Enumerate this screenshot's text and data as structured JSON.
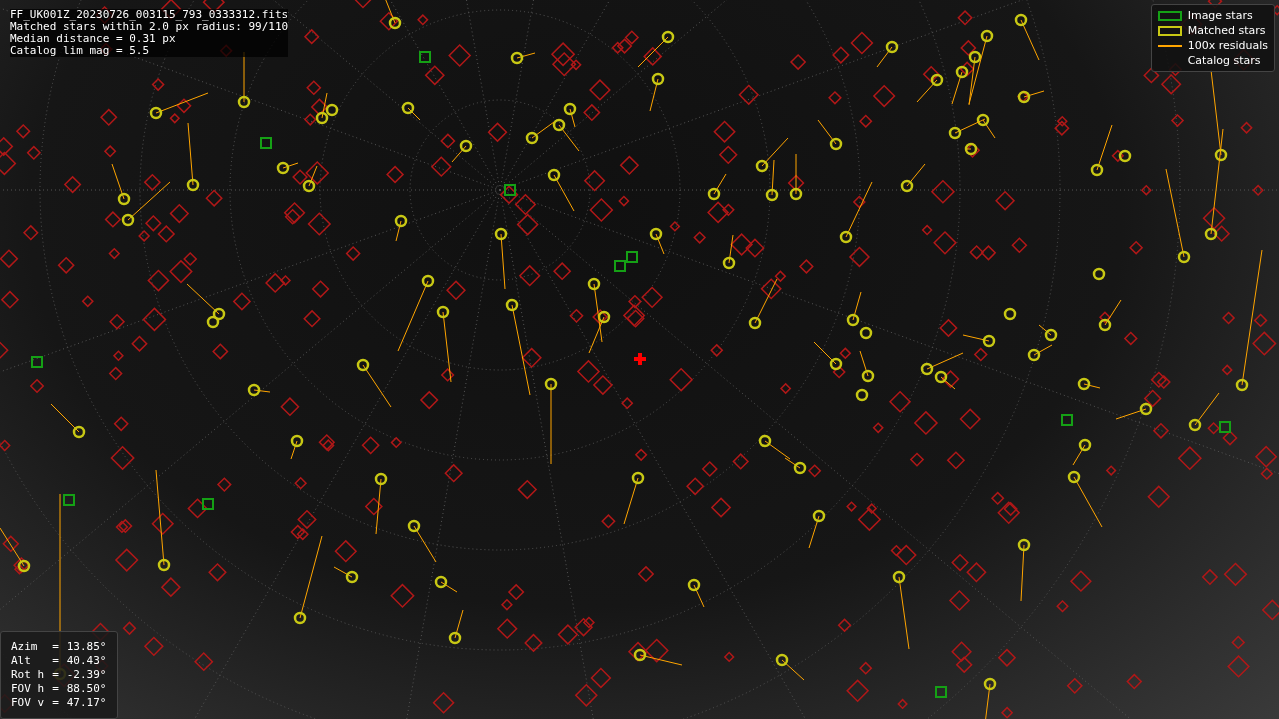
{
  "header_lines": [
    "FF_UK001Z_20230726_003115_793_0333312.fits",
    "Matched stars within 2.0 px radius: 99/110",
    "Median distance = 0.31 px",
    "Catalog lim mag = 5.5"
  ],
  "legend": [
    {
      "kind": "image",
      "label": "Image stars"
    },
    {
      "kind": "matched",
      "label": "Matched stars"
    },
    {
      "kind": "residual",
      "label": "100x residuals"
    },
    {
      "kind": "catalog",
      "label": "Catalog stars"
    }
  ],
  "pointing": [
    {
      "label": "Azim",
      "sep": "=",
      "value": "13.85°"
    },
    {
      "label": "Alt",
      "sep": "=",
      "value": "40.43°"
    },
    {
      "label": "Rot h",
      "sep": "=",
      "value": "-2.39°"
    },
    {
      "label": "FOV h",
      "sep": "=",
      "value": "88.50°"
    },
    {
      "label": "FOV v",
      "sep": "=",
      "value": "47.17°"
    }
  ]
}
